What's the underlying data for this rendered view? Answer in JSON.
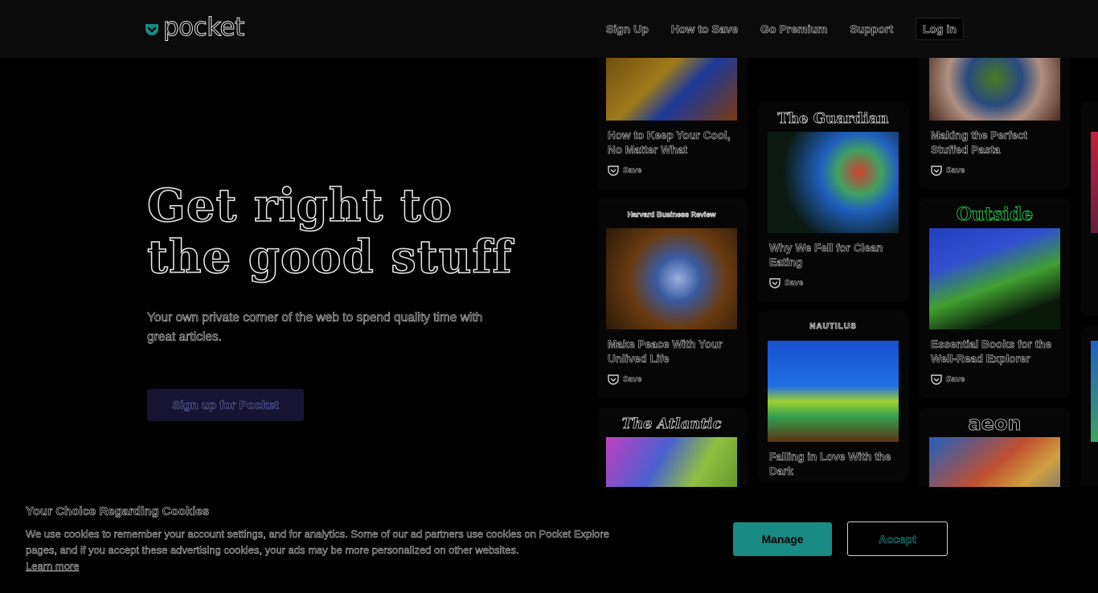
{
  "brand": {
    "name": "pocket",
    "accent": "#1a8a84",
    "cta_bg": "#161432"
  },
  "nav": {
    "items": [
      "Sign Up",
      "How to Save",
      "Go Premium",
      "Support"
    ],
    "login": "Log in"
  },
  "hero": {
    "title_line1": "Get right to",
    "title_line2": "the good stuff",
    "subtitle": "Your own private corner of the web to spend quality time with great articles.",
    "cta": "Sign up for Pocket"
  },
  "cards": [
    {
      "publisher": "",
      "title": "How to Keep Your Cool, No Matter What",
      "save": "Save"
    },
    {
      "publisher": "Harvard Business Review",
      "title": "Make Peace With Your Unlived Life",
      "save": "Save"
    },
    {
      "publisher": "The Atlantic",
      "title": "",
      "save": ""
    },
    {
      "publisher": "The Guardian",
      "title": "Why We Fell for Clean Eating",
      "save": "Save"
    },
    {
      "publisher": "NAUTILUS",
      "title": "Falling in Love With the Dark",
      "save": ""
    },
    {
      "publisher": "",
      "title": "Making the Perfect Stuffed Pasta",
      "save": "Save"
    },
    {
      "publisher": "Outside",
      "title": "Essential Books for the Well-Read Explorer",
      "save": "Save"
    },
    {
      "publisher": "aeon",
      "title": "",
      "save": ""
    }
  ],
  "cookie": {
    "title": "Your Choice Regarding Cookies",
    "text": "We use cookies to remember your account settings, and for analytics. Some of our ad partners use cookies on Pocket Explore pages, and if you accept these advertising cookies, your ads may be more personalized on other websites.",
    "link": "Learn more",
    "manage": "Manage",
    "accept": "Accept"
  }
}
